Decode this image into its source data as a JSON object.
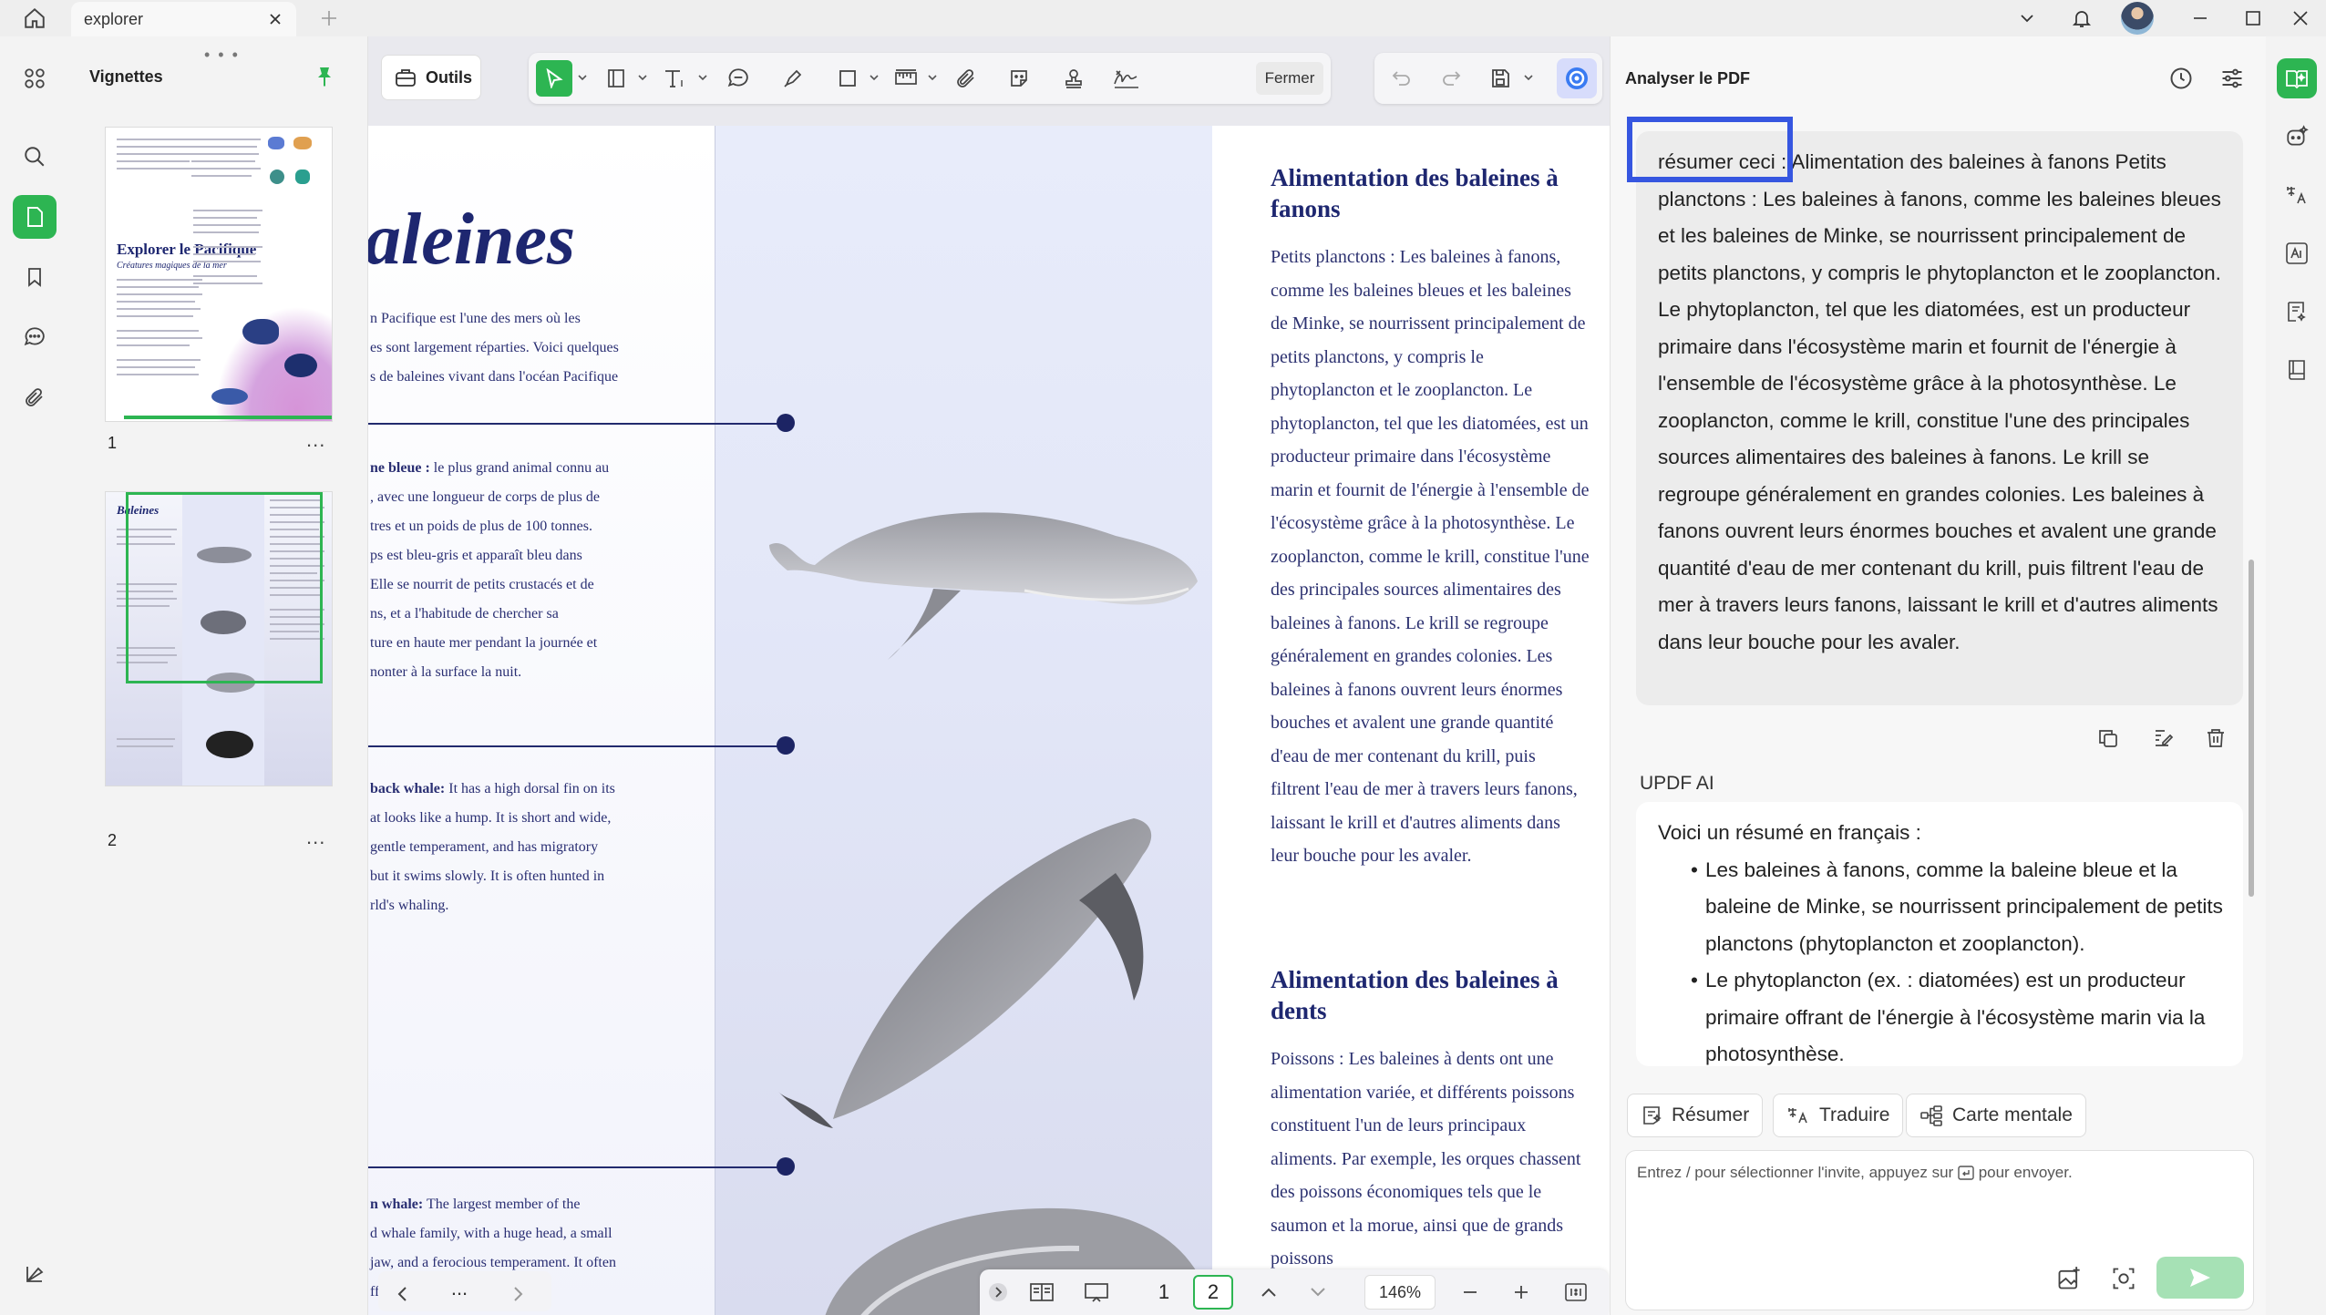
{
  "titlebar": {
    "tab_label": "explorer"
  },
  "thumbnails": {
    "title": "Vignettes",
    "page1": {
      "number": "1",
      "title": "Explorer le Pacifique",
      "subtitle": "Créatures magiques de la mer"
    },
    "page2": {
      "number": "2",
      "title": "Baleines"
    },
    "more": "..."
  },
  "toolbar": {
    "tools_label": "Outils",
    "close_label": "Fermer"
  },
  "document": {
    "big_title": "aleines",
    "intro": "n Pacifique est l'une des mers où les\nes sont largement réparties. Voici quelques\ns de baleines vivant dans l'océan Pacifique",
    "blue_whale_bold": "ne bleue :",
    "blue_whale_text": " le plus grand animal connu au\n, avec une longueur de corps de plus de\ntres et un poids de plus de 100 tonnes.\nps est bleu-gris et apparaît bleu dans\nElle se nourrit de petits crustacés et de\nns, et a l'habitude de chercher sa\nture en haute mer pendant la journée et\nnonter à la surface la nuit.",
    "humpback_bold": "back whale:",
    "humpback_text": " It has a high dorsal fin on its\nat looks like a hump. It is short and wide,\ngentle temperament, and has migratory\n but it swims slowly. It is often hunted in\nrld's whaling.",
    "sperm_bold": "n whale:",
    "sperm_text": " The largest member of the\nd whale family, with a huge head, a small\njaw, and a ferocious temperament. It often\nfficult to digest",
    "baleen_heading": "Alimentation des baleines à fanons",
    "baleen_text": "Petits planctons : Les baleines à fanons, comme les baleines bleues et les baleines de Minke, se nourrissent principalement de petits planctons, y compris le phytoplancton et le zooplancton. Le phytoplancton, tel que les diatomées, est un producteur primaire dans l'écosystème marin et fournit de l'énergie à l'ensemble de l'écosystème grâce à la photosynthèse. Le zooplancton, comme le krill, constitue l'une des principales sources alimentaires des baleines à fanons. Le krill se regroupe généralement en grandes colonies. Les baleines à fanons ouvrent leurs énormes bouches et avalent une grande quantité d'eau de mer contenant du krill, puis filtrent l'eau de mer à travers leurs fanons, laissant le krill et d'autres aliments dans leur bouche pour les avaler.",
    "toothed_heading": "Alimentation des baleines à dents",
    "toothed_text": "Poissons : Les baleines à dents ont une alimentation variée, et différents poissons constituent l'un de leurs principaux aliments. Par exemple, les orques chassent des poissons économiques tels que le saumon et la morue, ainsi que de grands poissons"
  },
  "bottom_nav": {
    "more": "...",
    "page_current": "1",
    "page_total": "2",
    "zoom": "146%"
  },
  "ai_panel": {
    "title": "Analyser le PDF",
    "user_prefix": "résumer ceci :",
    "user_message": " Alimentation des baleines à fanons Petits planctons : Les baleines à fanons, comme les baleines bleues et les baleines de Minke, se nourrissent principalement de petits planctons, y compris le phytoplancton et le zooplancton. Le phytoplancton, tel que les diatomées, est un producteur primaire dans l'écosystème marin et fournit de l'énergie à l'ensemble de l'écosystème grâce à la photosynthèse. Le zooplancton, comme le krill, constitue l'une des principales sources alimentaires des baleines à fanons. Le krill se regroupe généralement en grandes colonies. Les baleines à fanons ouvrent leurs énormes bouches et avalent une grande quantité d'eau de mer contenant du krill, puis filtrent l'eau de mer à travers leurs fanons, laissant le krill et d'autres aliments dans leur bouche pour les avaler.",
    "ai_label": "UPDF AI",
    "ai_intro": "Voici un résumé en français :",
    "ai_bullets": [
      "Les baleines à fanons, comme la baleine bleue et la baleine de Minke, se nourrissent principalement de petits planctons (phytoplancton et zooplancton).",
      "Le phytoplancton (ex. : diatomées) est un producteur primaire offrant de l'énergie à l'écosystème marin via la photosynthèse."
    ],
    "chips": {
      "summarize": "Résumer",
      "translate": "Traduire",
      "mindmap": "Carte mentale"
    },
    "prompt_placeholder_a": "Entrez / pour sélectionner l'invite, appuyez sur",
    "prompt_placeholder_b": "pour envoyer."
  },
  "colors": {
    "accent_green": "#2db552",
    "highlight_blue": "#3656e0",
    "doc_navy": "#1e2770"
  }
}
